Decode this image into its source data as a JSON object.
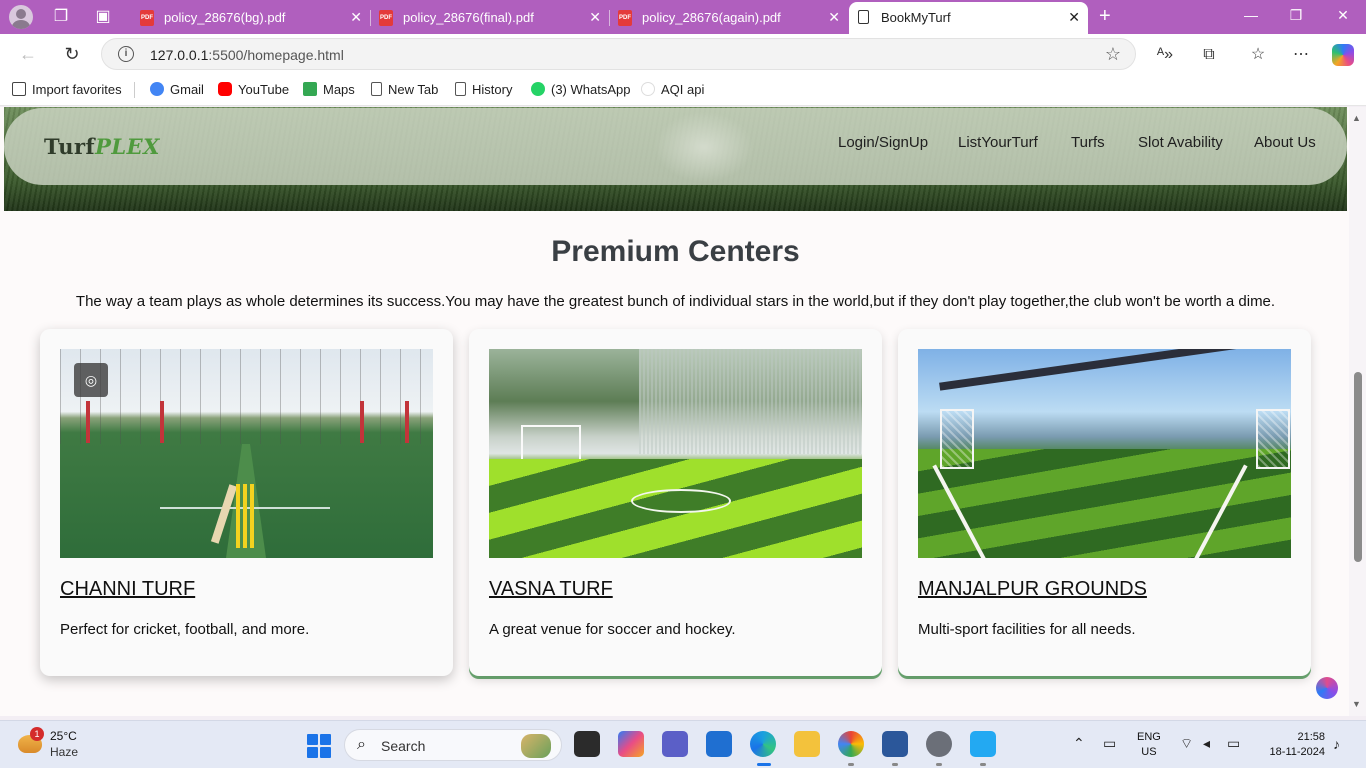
{
  "browser": {
    "tabs": [
      {
        "title": "policy_28676(bg).pdf",
        "icon": "pdf-icon",
        "active": false
      },
      {
        "title": "policy_28676(final).pdf",
        "icon": "pdf-icon",
        "active": false
      },
      {
        "title": "policy_28676(again).pdf",
        "icon": "pdf-icon",
        "active": false
      },
      {
        "title": "BookMyTurf",
        "icon": "page-icon",
        "active": true
      }
    ],
    "new_tab": "+",
    "url_host": "127.0.0.1",
    "url_rest": ":5500/homepage.html",
    "favorites": [
      {
        "label": "Import favorites",
        "icon": "import-icon",
        "color": "#444444"
      },
      {
        "label": "Gmail",
        "icon": "google-icon",
        "color": "#4285f4"
      },
      {
        "label": "YouTube",
        "icon": "youtube-icon",
        "color": "#ff0000"
      },
      {
        "label": "Maps",
        "icon": "maps-icon",
        "color": "#34a853"
      },
      {
        "label": "New Tab",
        "icon": "page-icon",
        "color": "#555555"
      },
      {
        "label": "History",
        "icon": "page-icon",
        "color": "#555555"
      },
      {
        "label": "(3) WhatsApp",
        "icon": "whatsapp-icon",
        "color": "#25d366"
      },
      {
        "label": "AQI api",
        "icon": "globe-icon",
        "color": "#dddddd"
      }
    ]
  },
  "site": {
    "logo_main": "Turf",
    "logo_accent": "PLEX",
    "nav": [
      "Login/SignUp",
      "ListYourTurf",
      "Turfs",
      "Slot Avability",
      "About Us"
    ],
    "section_title": "Premium Centers",
    "quote": "The way a team plays as whole determines its success.You may have the greatest bunch of individual stars in the world,but if they don't play together,the club won't be worth a dime.",
    "cards": [
      {
        "title": "CHANNI TURF",
        "desc": "Perfect for cricket, football, and more."
      },
      {
        "title": "VASNA TURF",
        "desc": "A great venue for soccer and hockey."
      },
      {
        "title": "MANJALPUR GROUNDS",
        "desc": "Multi-sport facilities for all needs."
      }
    ]
  },
  "taskbar": {
    "weather_temp": "25°C",
    "weather_cond": "Haze",
    "weather_badge": "1",
    "search_placeholder": "Search",
    "lang_line1": "ENG",
    "lang_line2": "US",
    "time": "21:58",
    "date": "18-11-2024"
  }
}
